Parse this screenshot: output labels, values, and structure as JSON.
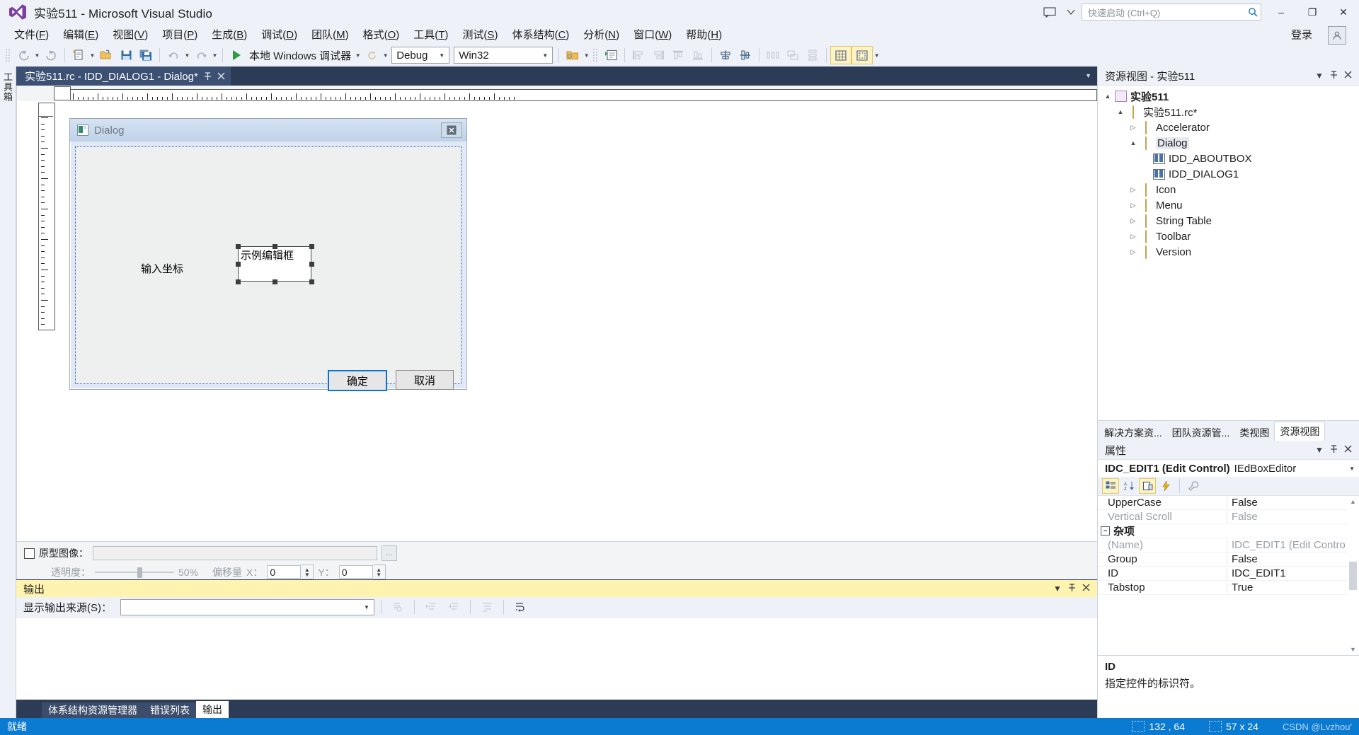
{
  "window": {
    "title": "实验511 - Microsoft Visual Studio",
    "logo_icon": "visual-studio-logo",
    "feedback_icon": "feedback-icon",
    "notify_icon": "notification-chevron-icon",
    "quick_launch_placeholder": "快速启动 (Ctrl+Q)",
    "search_icon": "search-icon",
    "minimize": "–",
    "maximize": "❐",
    "close": "✕",
    "signin_label": "登录",
    "account_icon": "account-icon"
  },
  "menubar": {
    "items": [
      {
        "text": "文件",
        "key": "F"
      },
      {
        "text": "编辑",
        "key": "E"
      },
      {
        "text": "视图",
        "key": "V"
      },
      {
        "text": "项目",
        "key": "P"
      },
      {
        "text": "生成",
        "key": "B"
      },
      {
        "text": "调试",
        "key": "D"
      },
      {
        "text": "团队",
        "key": "M"
      },
      {
        "text": "格式",
        "key": "O"
      },
      {
        "text": "工具",
        "key": "T"
      },
      {
        "text": "测试",
        "key": "S"
      },
      {
        "text": "体系结构",
        "key": "C"
      },
      {
        "text": "分析",
        "key": "N"
      },
      {
        "text": "窗口",
        "key": "W"
      },
      {
        "text": "帮助",
        "key": "H"
      }
    ]
  },
  "toolbar": {
    "back_icon": "navigate-back-icon",
    "forward_icon": "navigate-forward-icon",
    "new_item_icon": "new-item-icon",
    "open_icon": "open-file-icon",
    "save_icon": "save-icon",
    "save_all_icon": "save-all-icon",
    "undo_icon": "undo-icon",
    "redo_icon": "redo-icon",
    "start_icon": "start-debug-icon",
    "start_label": "本地 Windows 调试器",
    "refresh_icon": "refresh-icon",
    "config_value": "Debug",
    "platform_value": "Win32",
    "folder_icon": "open-folder-icon",
    "props_icon": "properties-window-icon",
    "align_left_icon": "align-left-icon",
    "align_right_icon": "align-right-icon",
    "align_top_icon": "align-top-icon",
    "align_bottom_icon": "align-bottom-icon",
    "center_h_icon": "center-horizontal-icon",
    "center_v_icon": "center-vertical-icon",
    "space_across_icon": "space-across-icon",
    "space_down_icon": "space-down-icon",
    "size_icon": "size-control-icon",
    "grid_icon": "toggle-grid-icon",
    "guides_icon": "toggle-guides-icon"
  },
  "toolbox_strip": {
    "label": "工具箱"
  },
  "document_tab": {
    "title": "实验511.rc - IDD_DIALOG1 - Dialog*",
    "pin_icon": "pin-icon",
    "close_icon": "close-icon",
    "tab_list_icon": "tab-list-chevron-icon"
  },
  "designer": {
    "dialog": {
      "caption_icon": "dialog-app-icon",
      "caption": "Dialog",
      "close_button": "✕",
      "label_text": "输入坐标",
      "edit_text": "示例编辑框",
      "ok_button": "确定",
      "cancel_button": "取消"
    }
  },
  "prototype_bar": {
    "checkbox_label": "原型图像：",
    "path_value": "",
    "browse_label": "...",
    "opacity_label": "透明度：",
    "opacity_value": "50%",
    "offset_label": "偏移量",
    "offset_x_label": "X：",
    "offset_x_value": "0",
    "offset_y_label": "Y：",
    "offset_y_value": "0"
  },
  "output_panel": {
    "title": "输出",
    "menu_icon": "panel-menu-icon",
    "pin_icon": "pin-icon",
    "close_icon": "close-icon",
    "source_label": "显示输出来源(S)：",
    "source_value": "",
    "tools": [
      {
        "icon": "find-message-icon"
      },
      {
        "icon": "go-previous-icon"
      },
      {
        "icon": "go-next-icon"
      },
      {
        "icon": "clear-all-icon"
      },
      {
        "icon": "toggle-wordwrap-icon"
      }
    ],
    "tabs": [
      {
        "label": "体系结构资源管理器",
        "selected": false
      },
      {
        "label": "错误列表",
        "selected": false
      },
      {
        "label": "输出",
        "selected": true
      }
    ]
  },
  "resource_view": {
    "title": "资源视图 - 实验511",
    "menu_icon": "panel-menu-icon",
    "pin_icon": "pin-icon",
    "close_icon": "close-icon",
    "tree": [
      {
        "label": "实验511",
        "level": 0,
        "expander": "▲",
        "icon": "project-icon",
        "bold": true
      },
      {
        "label": "实验511.rc*",
        "level": 1,
        "expander": "▲",
        "icon": "folder-open-icon",
        "bold": false
      },
      {
        "label": "Accelerator",
        "level": 2,
        "expander": "▷",
        "icon": "folder-icon",
        "bold": false
      },
      {
        "label": "Dialog",
        "level": 2,
        "expander": "▲",
        "icon": "folder-open-icon",
        "bold": false,
        "selected": true
      },
      {
        "label": "IDD_ABOUTBOX",
        "level": 3,
        "expander": "",
        "icon": "dialog-resource-icon",
        "bold": false
      },
      {
        "label": "IDD_DIALOG1",
        "level": 3,
        "expander": "",
        "icon": "dialog-resource-icon",
        "bold": false
      },
      {
        "label": "Icon",
        "level": 2,
        "expander": "▷",
        "icon": "folder-icon",
        "bold": false
      },
      {
        "label": "Menu",
        "level": 2,
        "expander": "▷",
        "icon": "folder-icon",
        "bold": false
      },
      {
        "label": "String Table",
        "level": 2,
        "expander": "▷",
        "icon": "folder-icon",
        "bold": false
      },
      {
        "label": "Toolbar",
        "level": 2,
        "expander": "▷",
        "icon": "folder-icon",
        "bold": false
      },
      {
        "label": "Version",
        "level": 2,
        "expander": "▷",
        "icon": "folder-icon",
        "bold": false
      }
    ]
  },
  "side_tabs": [
    {
      "label": "解决方案资...",
      "selected": false
    },
    {
      "label": "团队资源管...",
      "selected": false
    },
    {
      "label": "类视图",
      "selected": false
    },
    {
      "label": "资源视图",
      "selected": true
    }
  ],
  "properties": {
    "title": "属性",
    "menu_icon": "panel-menu-icon",
    "pin_icon": "pin-icon",
    "close_icon": "close-icon",
    "object_name": "IDC_EDIT1 (Edit Control)",
    "object_type": "IEdBoxEditor",
    "dropdown_icon": "chevron-down-icon",
    "tools": [
      {
        "icon": "categorized-icon",
        "active": true
      },
      {
        "icon": "alphabetical-sort-icon",
        "active": false
      },
      {
        "icon": "properties-page-icon",
        "active": true
      },
      {
        "icon": "events-lightning-icon",
        "active": false
      },
      {
        "icon": "property-pages-wrench-icon",
        "active": false
      }
    ],
    "rows": [
      {
        "key": "UpperCase",
        "value": "False",
        "type": "item",
        "dim": false
      },
      {
        "key": "Vertical Scroll",
        "value": "False",
        "type": "item",
        "dim": true
      },
      {
        "key": "杂项",
        "value": "",
        "type": "group",
        "dim": false
      },
      {
        "key": "(Name)",
        "value": "IDC_EDIT1 (Edit Contro",
        "type": "item",
        "dim": true
      },
      {
        "key": "Group",
        "value": "False",
        "type": "item",
        "dim": false
      },
      {
        "key": "ID",
        "value": "IDC_EDIT1",
        "type": "item",
        "dim": false
      },
      {
        "key": "Tabstop",
        "value": "True",
        "type": "item",
        "dim": false
      }
    ],
    "desc_title": "ID",
    "desc_text": "指定控件的标识符。",
    "scroll_up_icon": "scroll-up-icon",
    "scroll_down_icon": "scroll-down-icon"
  },
  "statusbar": {
    "ready": "就绪",
    "position_icon": "position-icon",
    "position": "132 , 64",
    "size_icon": "size-icon",
    "size": "57 x 24",
    "watermark": "CSDN @Lvzhou'"
  }
}
